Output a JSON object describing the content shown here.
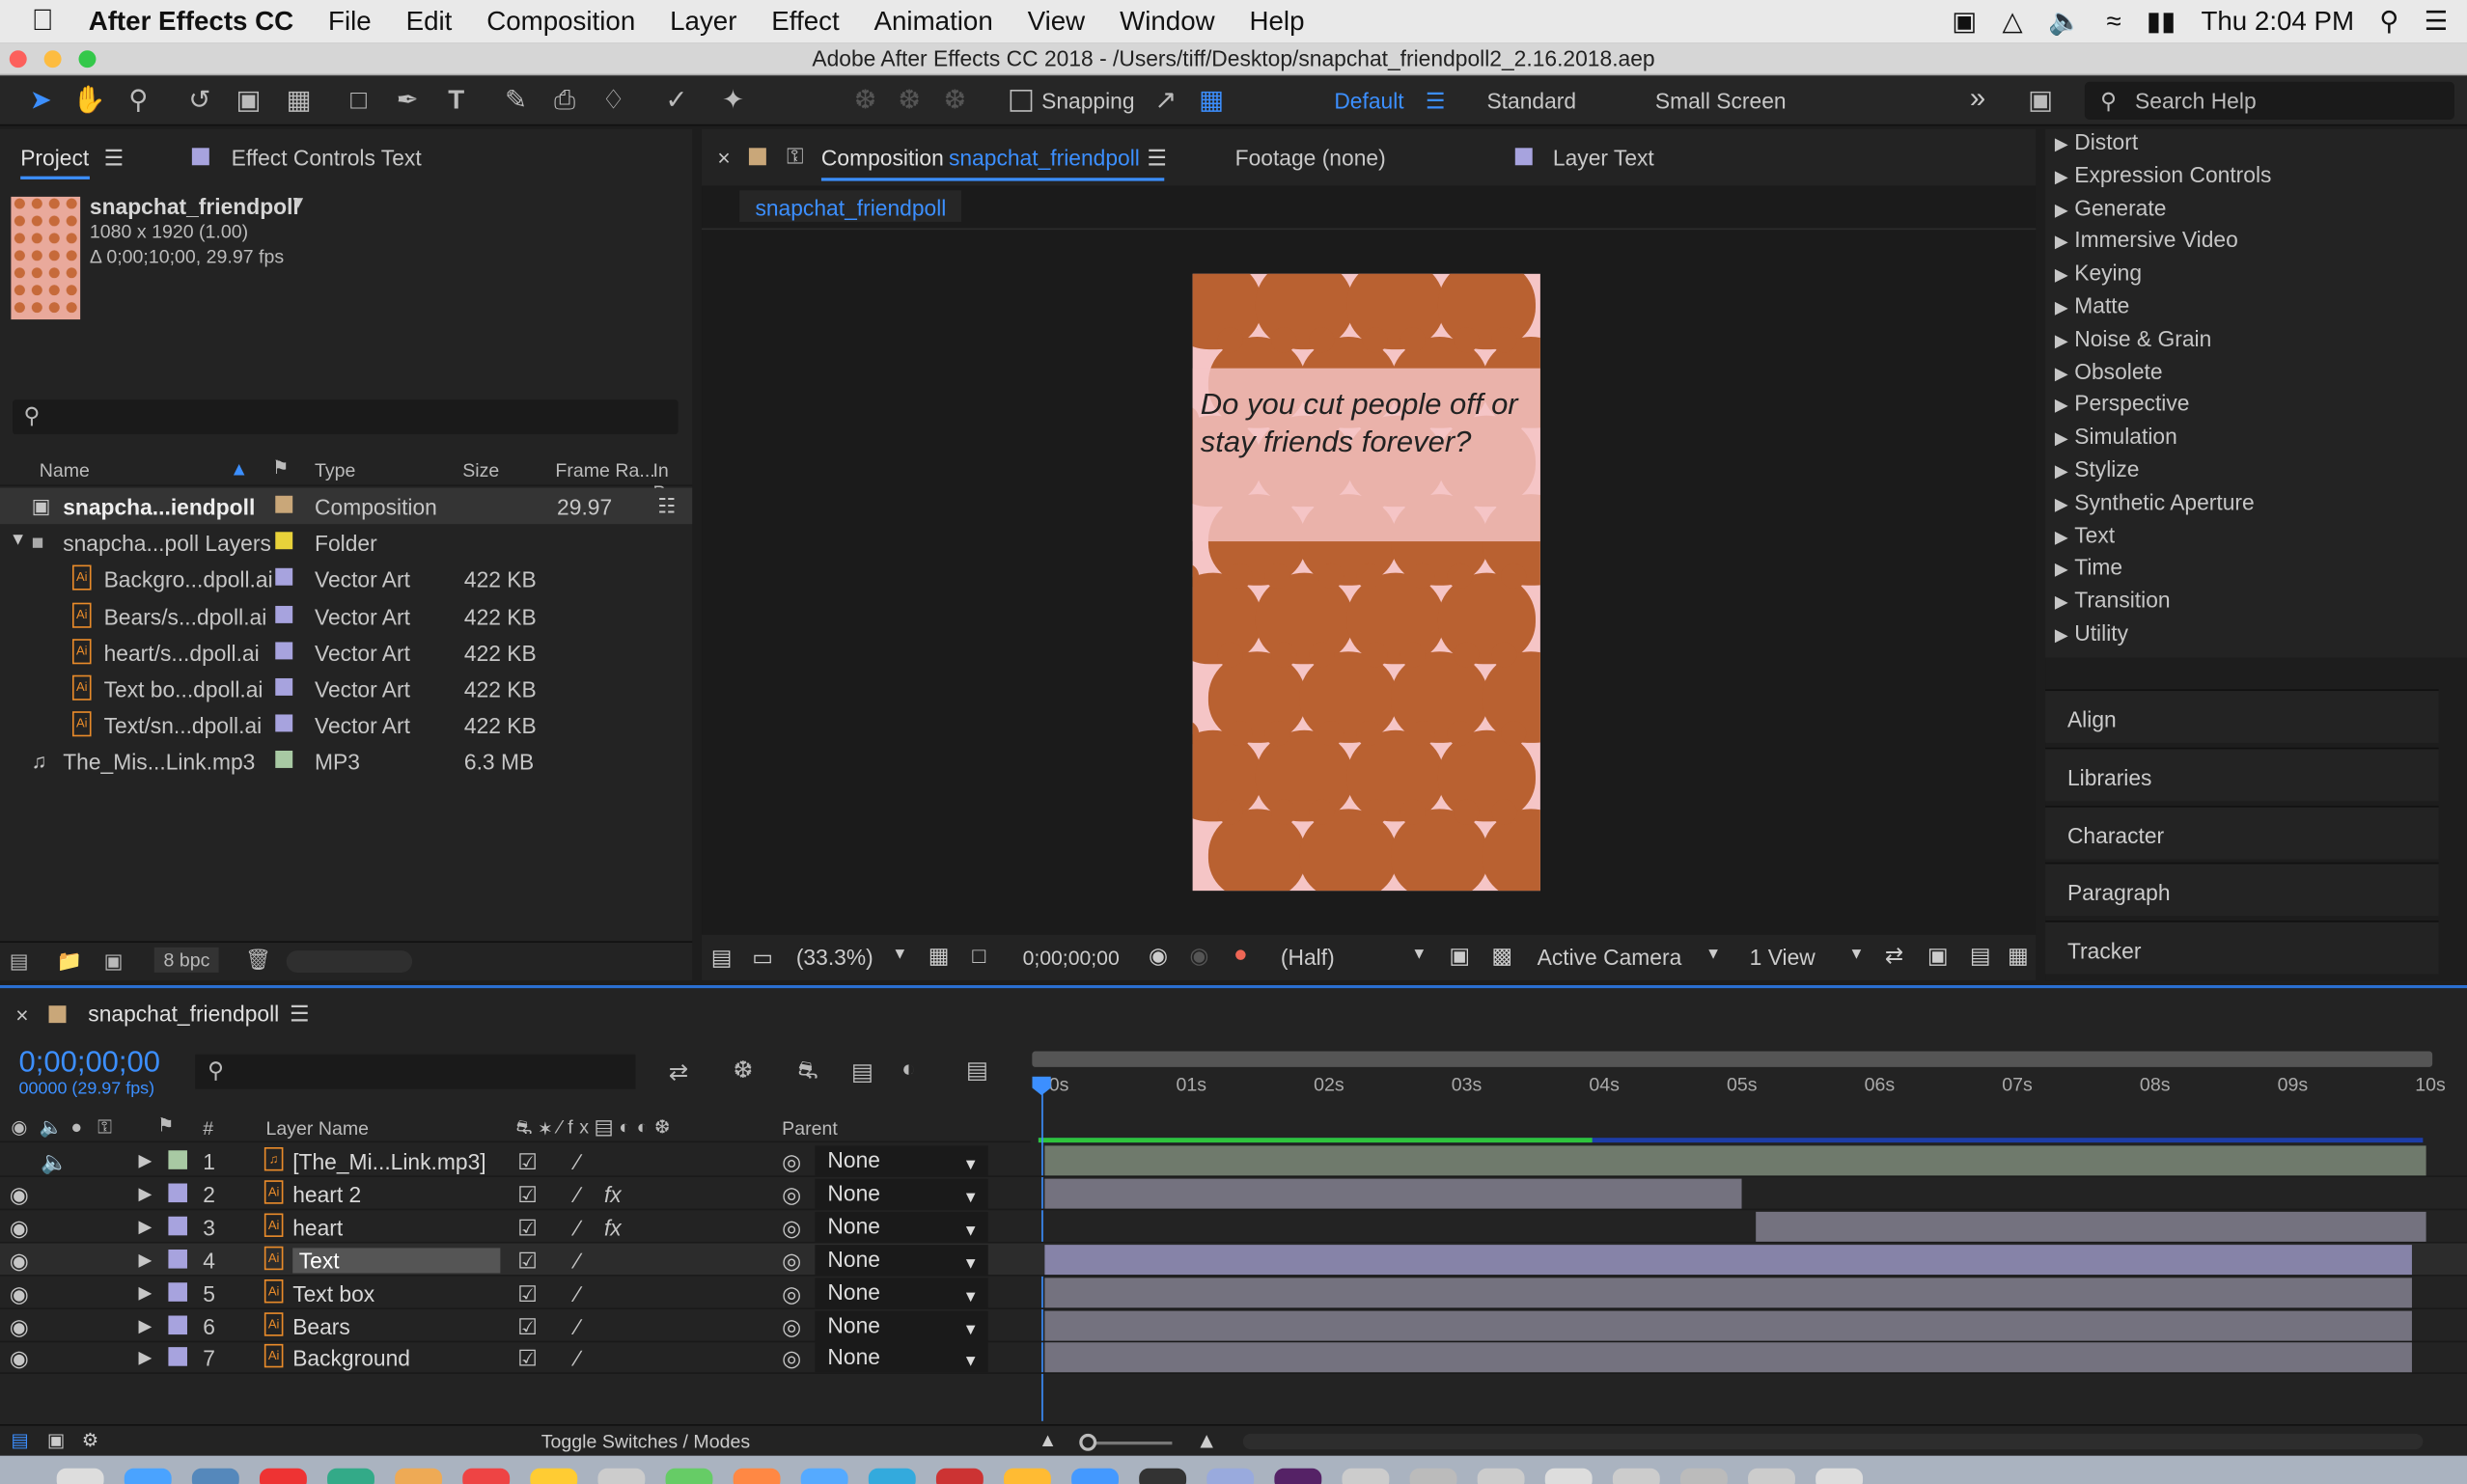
{
  "menubar": {
    "app": "After Effects CC",
    "items": [
      "File",
      "Edit",
      "Composition",
      "Layer",
      "Effect",
      "Animation",
      "View",
      "Window",
      "Help"
    ],
    "clock": "Thu 2:04 PM"
  },
  "window": {
    "title": "Adobe After Effects CC 2018 - /Users/tiff/Desktop/snapchat_friendpoll2_2.16.2018.aep"
  },
  "toolbar": {
    "snapping": "Snapping",
    "workspaces": [
      "Default",
      "Standard",
      "Small Screen"
    ],
    "search_placeholder": "Search Help"
  },
  "project": {
    "tab": "Project",
    "effect_controls_tab": "Effect Controls Text",
    "item_name": "snapchat_friendpoll",
    "item_dims": "1080 x 1920 (1.00)",
    "item_duration": "Δ 0;00;10;00, 29.97 fps",
    "columns": [
      "Name",
      "Type",
      "Size",
      "Frame Ra...",
      "In Po"
    ],
    "rows": [
      {
        "name": "snapcha...iendpoll",
        "type": "Composition",
        "size": "",
        "fps": "29.97",
        "color": "#c9a779"
      },
      {
        "name": "snapcha...poll Layers",
        "type": "Folder",
        "size": "",
        "fps": "",
        "color": "#e8d23a"
      },
      {
        "name": "Backgro...dpoll.ai",
        "type": "Vector Art",
        "size": "422 KB",
        "fps": "",
        "color": "#a7a3de"
      },
      {
        "name": "Bears/s...dpoll.ai",
        "type": "Vector Art",
        "size": "422 KB",
        "fps": "",
        "color": "#a7a3de"
      },
      {
        "name": "heart/s...dpoll.ai",
        "type": "Vector Art",
        "size": "422 KB",
        "fps": "",
        "color": "#a7a3de"
      },
      {
        "name": "Text bo...dpoll.ai",
        "type": "Vector Art",
        "size": "422 KB",
        "fps": "",
        "color": "#a7a3de"
      },
      {
        "name": "Text/sn...dpoll.ai",
        "type": "Vector Art",
        "size": "422 KB",
        "fps": "",
        "color": "#a7a3de"
      },
      {
        "name": "The_Mis...Link.mp3",
        "type": "MP3",
        "size": "6.3 MB",
        "fps": "",
        "color": "#a8c9a3"
      }
    ],
    "bpc": "8 bpc"
  },
  "viewer": {
    "tab_prefix": "Composition",
    "comp_name": "snapchat_friendpoll",
    "footage_tab": "Footage (none)",
    "layer_tab": "Layer Text",
    "breadcrumb": "snapchat_friendpoll",
    "question": "Do you cut people off or stay friends forever?",
    "zoom": "(33.3%)",
    "timecode": "0;00;00;00",
    "resolution": "(Half)",
    "camera": "Active Camera",
    "views": "1 View"
  },
  "effects": {
    "items": [
      "Distort",
      "Expression Controls",
      "Generate",
      "Immersive Video",
      "Keying",
      "Matte",
      "Noise & Grain",
      "Obsolete",
      "Perspective",
      "Simulation",
      "Stylize",
      "Synthetic Aperture",
      "Text",
      "Time",
      "Transition",
      "Utility"
    ]
  },
  "side_panels": [
    "Align",
    "Libraries",
    "Character",
    "Paragraph",
    "Tracker"
  ],
  "timeline": {
    "comp": "snapchat_friendpoll",
    "timecode": "0;00;00;00",
    "frames": "00000 (29.97 fps)",
    "col_layer_name": "Layer Name",
    "col_hash": "#",
    "col_parent": "Parent",
    "ticks": [
      "00s",
      "01s",
      "02s",
      "03s",
      "04s",
      "05s",
      "06s",
      "07s",
      "08s",
      "09s",
      "10s"
    ],
    "layers": [
      {
        "num": "1",
        "name": "[The_Mi...Link.mp3]",
        "parent": "None",
        "fx": "",
        "start": 0.0,
        "end": 1.0,
        "color": "#a8c9a3"
      },
      {
        "num": "2",
        "name": "heart 2",
        "parent": "None",
        "fx": "fx",
        "start": 0.0,
        "end": 0.505,
        "color": "#a7a3de"
      },
      {
        "num": "3",
        "name": "heart",
        "parent": "None",
        "fx": "fx",
        "start": 0.515,
        "end": 1.0,
        "color": "#a7a3de"
      },
      {
        "num": "4",
        "name": "Text",
        "parent": "None",
        "fx": "",
        "start": 0.0,
        "end": 0.99,
        "color": "#a7a3de"
      },
      {
        "num": "5",
        "name": "Text box",
        "parent": "None",
        "fx": "",
        "start": 0.0,
        "end": 0.99,
        "color": "#a7a3de"
      },
      {
        "num": "6",
        "name": "Bears",
        "parent": "None",
        "fx": "",
        "start": 0.0,
        "end": 0.99,
        "color": "#a7a3de"
      },
      {
        "num": "7",
        "name": "Background",
        "parent": "None",
        "fx": "",
        "start": 0.0,
        "end": 0.99,
        "color": "#a7a3de"
      }
    ],
    "toggle": "Toggle Switches / Modes"
  }
}
